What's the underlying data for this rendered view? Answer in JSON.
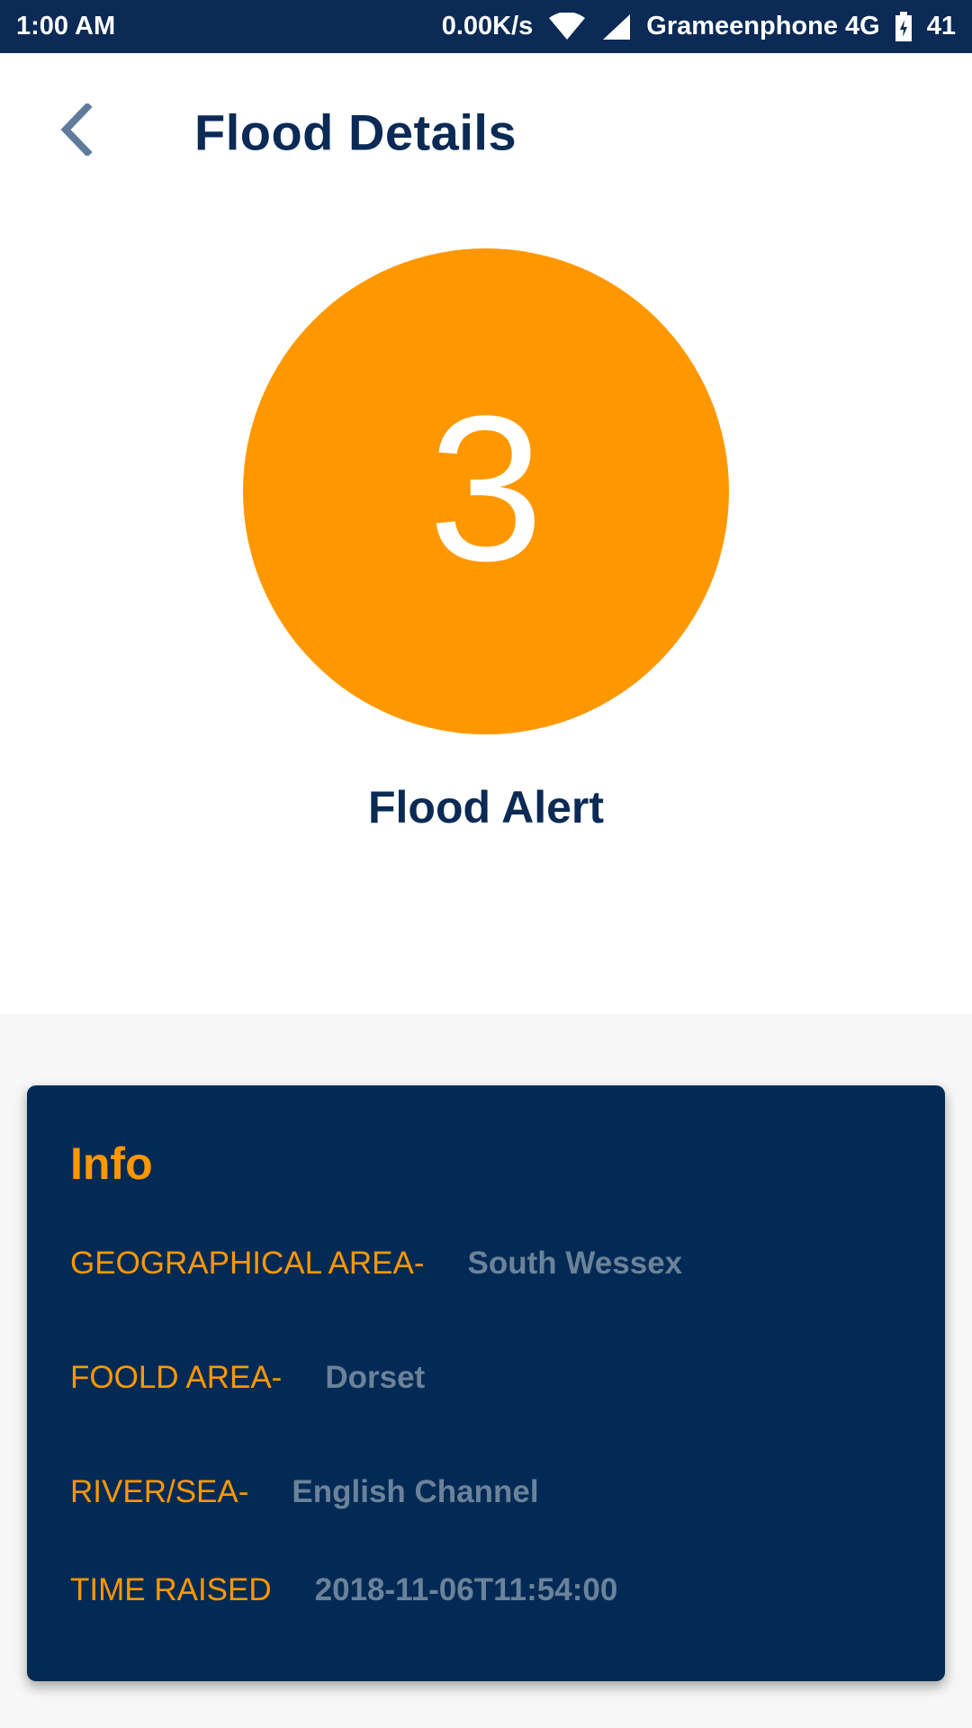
{
  "status_bar": {
    "time": "1:00 AM",
    "speed": "0.00K/s",
    "carrier": "Grameenphone 4G",
    "battery": "41",
    "icons": [
      "wifi-icon",
      "signal-icon",
      "battery-icon"
    ]
  },
  "header": {
    "title": "Flood Details",
    "back_icon": "chevron-left-icon"
  },
  "alert": {
    "level": "3",
    "label": "Flood Alert",
    "color": "#ff9800"
  },
  "info": {
    "title": "Info",
    "rows": [
      {
        "key": "GEOGRAPHICAL AREA-",
        "value": "South Wessex"
      },
      {
        "key": "FOOLD AREA-",
        "value": "Dorset"
      },
      {
        "key": "RIVER/SEA-",
        "value": "English Channel"
      },
      {
        "key": "TIME RAISED",
        "value": "2018-11-06T11:54:00"
      }
    ]
  },
  "colors": {
    "navy": "#0b2a55",
    "card": "#032a55",
    "accent": "#ff9800",
    "muted_value": "#6b8299"
  }
}
